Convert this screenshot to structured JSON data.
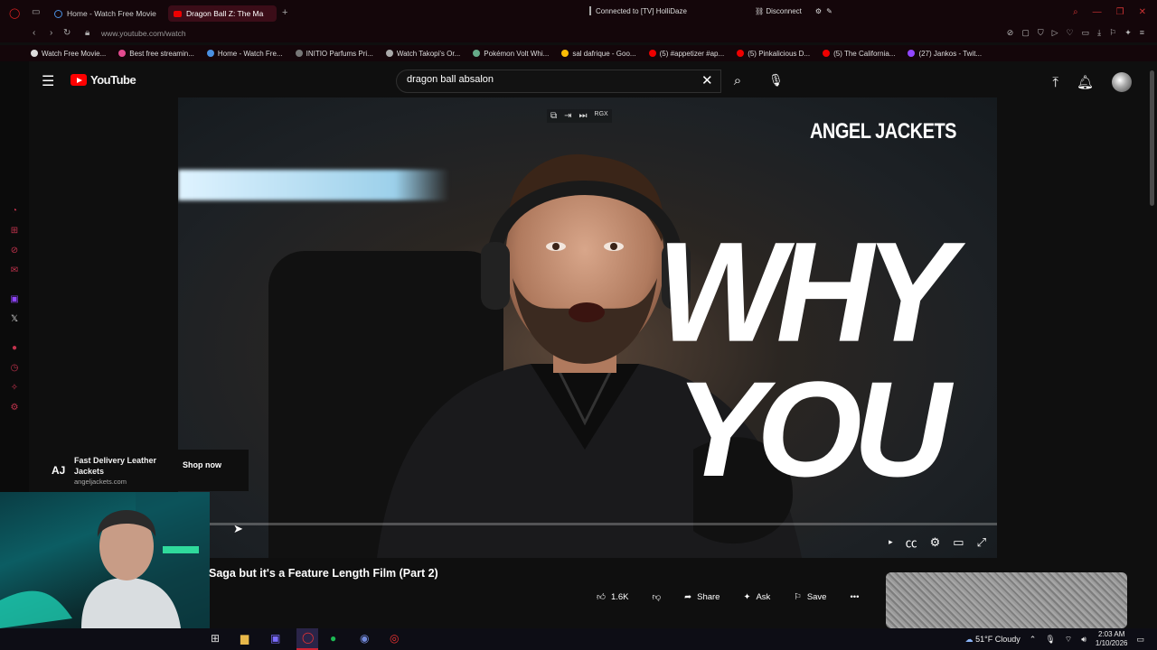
{
  "browser": {
    "tabs": [
      {
        "label": "Home - Watch Free Movie",
        "active": false
      },
      {
        "label": "Dragon Ball Z: The Ma",
        "active": true
      }
    ],
    "vpn_status": "Connected to [TV] HolliDaze",
    "disconnect_label": "Disconnect",
    "url": "www.youtube.com/watch",
    "bookmarks": [
      "Watch Free Movie...",
      "Best free streamin...",
      "Home - Watch Fre...",
      "INITIO Parfums Pri...",
      "Watch Takopi's Or...",
      "Pokémon Volt Whi...",
      "sal dafrique - Goo...",
      "(5) #appetizer #ap...",
      "(5) Pinkalicious D...",
      "(5) The California...",
      "(27) Jankos - Twit..."
    ]
  },
  "youtube": {
    "logo_text": "YouTube",
    "search_query": "dragon ball absalon"
  },
  "video": {
    "brand_overlay": "ANGEL JACKETS",
    "overlay_line1": "WHY",
    "overlay_line2": "YOU",
    "pip_label": "RGX",
    "title": "Saga but it's a Feature Length Film (Part 2)"
  },
  "ad": {
    "logo": "AJ",
    "title": "Fast Delivery Leather Jackets",
    "domain": "angeljackets.com",
    "cta": "Shop now"
  },
  "actions": {
    "likes": "1.6K",
    "share": "Share",
    "ask": "Ask",
    "save": "Save"
  },
  "taskbar": {
    "weather": "51°F  Cloudy",
    "time": "2:03 AM",
    "date": "1/10/2026"
  }
}
